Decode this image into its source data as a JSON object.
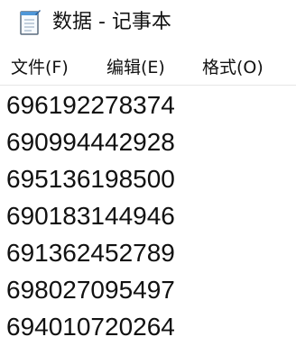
{
  "window": {
    "title": "数据 - 记事本",
    "icon": "notepad-icon"
  },
  "menu": {
    "file": "文件(F)",
    "edit": "编辑(E)",
    "format": "格式(O)"
  },
  "editor": {
    "lines": [
      "696192278374",
      "690994442928",
      "695136198500",
      "690183144946",
      "691362452789",
      "698027095497",
      "694010720264"
    ]
  }
}
